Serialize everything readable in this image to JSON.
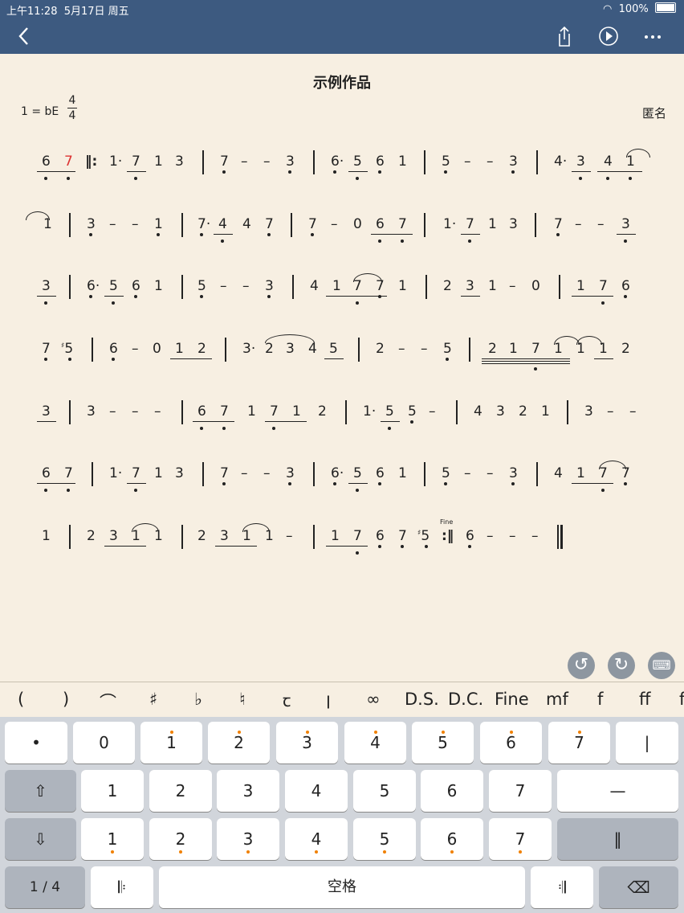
{
  "status": {
    "time": "上午11:28",
    "date": "5月17日 周五",
    "battery": "100%"
  },
  "nav": {
    "back_icon": "chevron-left-icon",
    "share_icon": "share-icon",
    "play_icon": "play-icon",
    "more_icon": "more-icon"
  },
  "score": {
    "title": "示例作品",
    "key": "1 = bE",
    "time_sig_top": "4",
    "time_sig_bottom": "4",
    "author": "匿名",
    "fine_label": "Fine"
  },
  "symbols": [
    "(",
    ")",
    "⌒",
    "♯",
    "♭",
    "♮",
    "ꞇ",
    "ꞁ",
    "∞",
    "D.S.",
    "D.C.",
    "Fine",
    "mf",
    "f",
    "ff",
    "f"
  ],
  "keyboard": {
    "row1": [
      "•",
      "0",
      "1",
      "2",
      "3",
      "4",
      "5",
      "6",
      "7",
      "|"
    ],
    "row2": [
      "⇧",
      "1",
      "2",
      "3",
      "4",
      "5",
      "6",
      "7",
      "—"
    ],
    "row3": [
      "⇩",
      "1",
      "2",
      "3",
      "4",
      "5",
      "6",
      "7",
      "‖"
    ],
    "row4": [
      "1 / 4",
      "𝄆",
      "空格",
      "𝄇",
      "⌫"
    ]
  },
  "colors": {
    "header": "#3d5a80",
    "paper": "#f7efe2",
    "highlight": "#d33333"
  }
}
